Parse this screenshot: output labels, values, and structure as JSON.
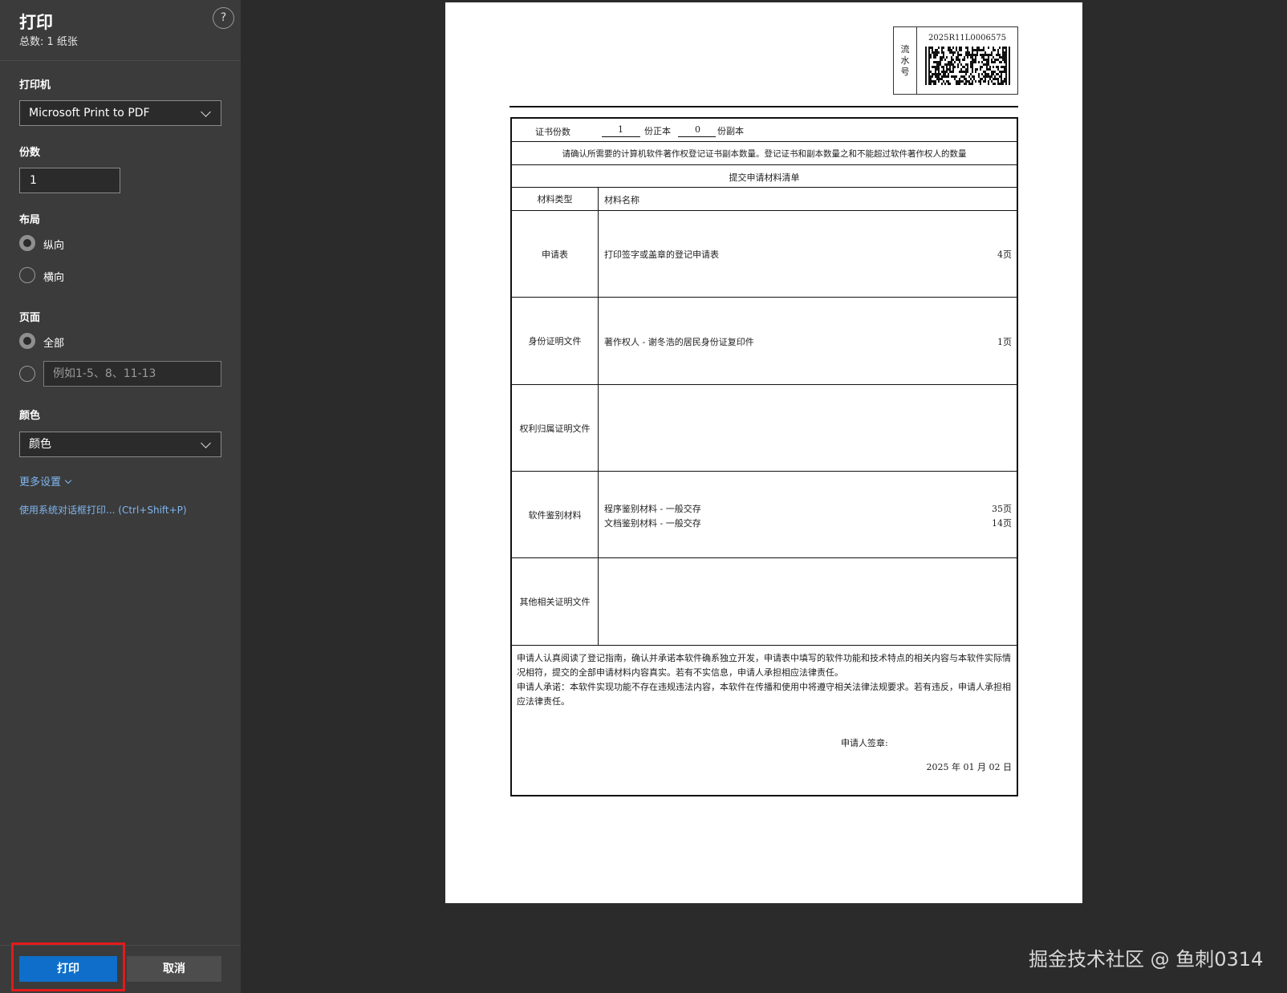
{
  "sidebar": {
    "title": "打印",
    "subtitle": "总数: 1 纸张",
    "help": "?",
    "printer": {
      "label": "打印机",
      "value": "Microsoft Print to PDF"
    },
    "copies": {
      "label": "份数",
      "value": "1"
    },
    "layout": {
      "label": "布局",
      "portrait": "纵向",
      "landscape": "横向",
      "selected": "纵向"
    },
    "pages": {
      "label": "页面",
      "all": "全部",
      "range_placeholder": "例如1-5、8、11-13",
      "selected": "全部"
    },
    "color": {
      "label": "颜色",
      "value": "颜色"
    },
    "more_settings": "更多设置",
    "system_dialog": "使用系统对话框打印... (Ctrl+Shift+P)",
    "print_button": "打印",
    "cancel_button": "取消"
  },
  "document": {
    "serial_label": [
      "流",
      "水",
      "号"
    ],
    "serial_code": "2025R11L0006575",
    "copies_row": {
      "label": "证书份数",
      "original_count": "1",
      "original_label": "份正本",
      "copy_count": "0",
      "copy_label": "份副本"
    },
    "notice": "请确认所需要的计算机软件著作权登记证书副本数量。登记证书和副本数量之和不能超过软件著作权人的数量",
    "list_title": "提交申请材料清单",
    "col_type": "材料类型",
    "col_name": "材料名称",
    "materials": [
      {
        "type": "申请表",
        "items": [
          {
            "name": "打印签字或盖章的登记申请表",
            "pages": "4页"
          }
        ]
      },
      {
        "type": "身份证明文件",
        "items": [
          {
            "name": "著作权人 - 谢冬浩的居民身份证复印件",
            "pages": "1页"
          }
        ]
      },
      {
        "type": "权利归属证明文件",
        "items": []
      },
      {
        "type": "软件鉴别材料",
        "items": [
          {
            "name": "程序鉴别材料 - 一般交存",
            "pages": "35页"
          },
          {
            "name": "文档鉴别材料 - 一般交存",
            "pages": "14页"
          }
        ]
      },
      {
        "type": "其他相关证明文件",
        "items": []
      }
    ],
    "declaration_1": "申请人认真阅读了登记指南，确认并承诺本软件确系独立开发，申请表中填写的软件功能和技术特点的相关内容与本软件实际情况相符，提交的全部申请材料内容真实。若有不实信息，申请人承担相应法律责任。",
    "declaration_2": "申请人承诺：本软件实现功能不存在违规违法内容，本软件在传播和使用中将遵守相关法律法规要求。若有违反，申请人承担相应法律责任。",
    "signature_label": "申请人签章:",
    "date": "2025 年 01 月 02 日"
  },
  "watermark": "掘金技术社区 @ 鱼刺0314"
}
